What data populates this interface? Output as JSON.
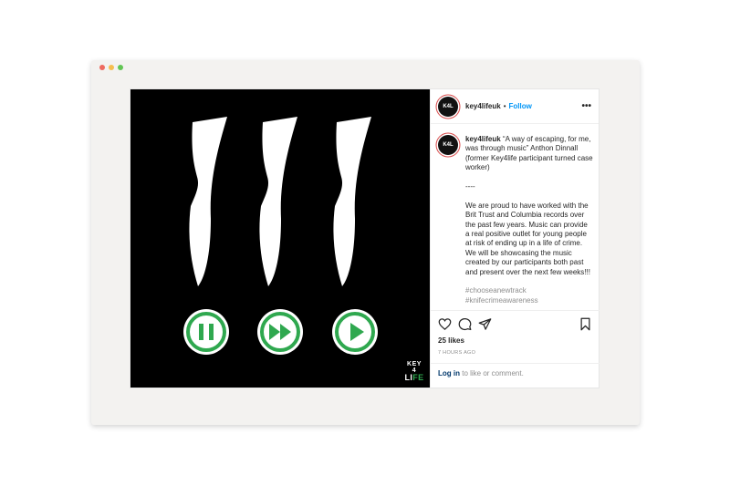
{
  "window": {
    "dot_colors": [
      "#ee6a5f",
      "#f5be4f",
      "#62c554"
    ]
  },
  "media": {
    "controls": [
      "pause-icon",
      "fast-forward-icon",
      "play-icon"
    ],
    "accent_color": "#2fa84f",
    "brand_line1": "KEY 4",
    "brand_line2_a": "LI",
    "brand_line2_b": "FE"
  },
  "post": {
    "avatar_text": "K4L",
    "username": "key4lifeuk",
    "separator": "•",
    "follow_label": "Follow",
    "more_label": "•••",
    "caption": {
      "username": "key4lifeuk",
      "quote": "“A way of escaping, for me, was through music” Anthon Dinnall (former Key4life participant turned case worker)",
      "divider": "----",
      "body": "We are proud to have worked with the Brit Trust and Columbia records over the past few years. Music can provide a real positive outlet for young people at risk of ending up in a life of crime. We will be showcasing the music created by our participants both past and present over the next few weeks!!!",
      "tags": [
        "#chooseanewtrack",
        "#knifecrimeawareness"
      ]
    },
    "likes": "25 likes",
    "time": "7 HOURS AGO",
    "login_link": "Log in",
    "login_text": " to like or comment."
  }
}
